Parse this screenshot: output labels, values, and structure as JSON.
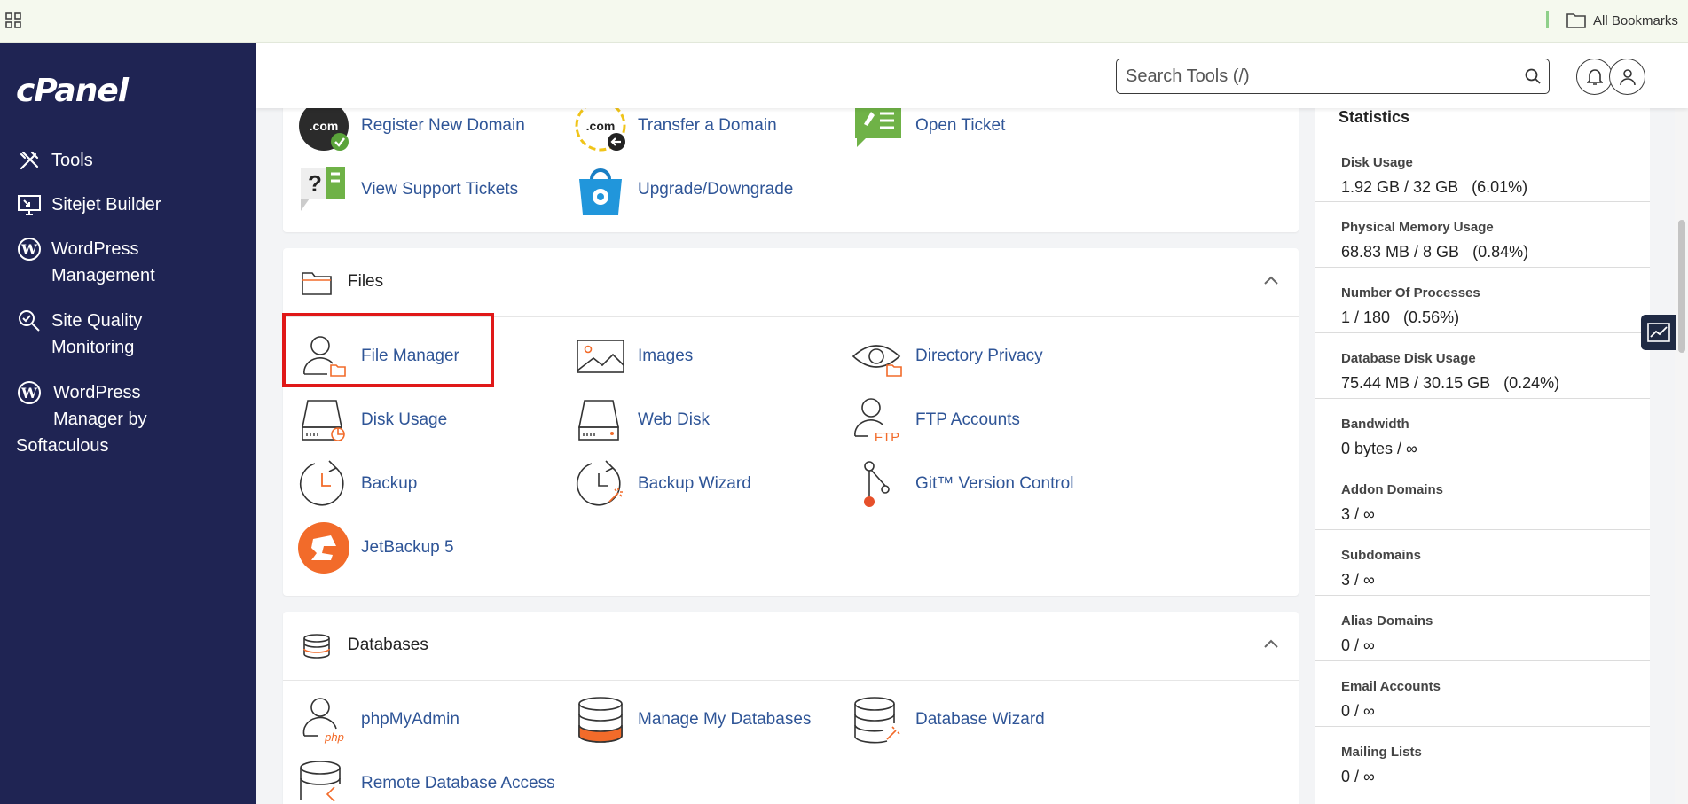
{
  "bookmarks_bar": {
    "all_bookmarks": "All Bookmarks"
  },
  "sidebar": {
    "logo": "cPanel",
    "items": [
      {
        "label_1": "Tools",
        "label_2": "",
        "icon": "tools-icon"
      },
      {
        "label_1": "Sitejet Builder",
        "label_2": "",
        "icon": "sitejet-icon"
      },
      {
        "label_1": "WordPress",
        "label_2": "Management",
        "icon": "wordpress-icon"
      },
      {
        "label_1": "Site Quality",
        "label_2": "Monitoring",
        "icon": "site-quality-icon"
      },
      {
        "label_1": "WordPress",
        "label_2": "Manager by",
        "label_3": "Softaculous",
        "icon": "wordpress-icon"
      }
    ]
  },
  "header": {
    "search_placeholder": "Search Tools (/)"
  },
  "domains_card": {
    "tools": [
      {
        "label": "Register New Domain",
        "icon": "register-domain-icon"
      },
      {
        "label": "Transfer a Domain",
        "icon": "transfer-domain-icon"
      },
      {
        "label": "Open Ticket",
        "icon": "open-ticket-icon"
      },
      {
        "label": "View Support Tickets",
        "icon": "support-tickets-icon"
      },
      {
        "label": "Upgrade/Downgrade",
        "icon": "upgrade-icon"
      }
    ]
  },
  "files_card": {
    "title": "Files",
    "tools": [
      {
        "label": "File Manager",
        "icon": "file-manager-icon"
      },
      {
        "label": "Images",
        "icon": "images-icon"
      },
      {
        "label": "Directory Privacy",
        "icon": "directory-privacy-icon"
      },
      {
        "label": "Disk Usage",
        "icon": "disk-usage-icon"
      },
      {
        "label": "Web Disk",
        "icon": "web-disk-icon"
      },
      {
        "label": "FTP Accounts",
        "icon": "ftp-accounts-icon"
      },
      {
        "label": "Backup",
        "icon": "backup-icon"
      },
      {
        "label": "Backup Wizard",
        "icon": "backup-wizard-icon"
      },
      {
        "label": "Git™ Version Control",
        "icon": "git-icon"
      },
      {
        "label": "JetBackup 5",
        "icon": "jetbackup-icon"
      }
    ]
  },
  "databases_card": {
    "title": "Databases",
    "tools": [
      {
        "label": "phpMyAdmin",
        "icon": "phpmyadmin-icon"
      },
      {
        "label": "Manage My Databases",
        "icon": "manage-databases-icon"
      },
      {
        "label": "Database Wizard",
        "icon": "database-wizard-icon"
      },
      {
        "label": "Remote Database Access",
        "icon": "remote-database-icon"
      }
    ]
  },
  "statistics": {
    "title": "Statistics",
    "rows": [
      {
        "label": "Disk Usage",
        "value": "1.92 GB / 32 GB   (6.01%)"
      },
      {
        "label": "Physical Memory Usage",
        "value": "68.83 MB / 8 GB   (0.84%)"
      },
      {
        "label": "Number Of Processes",
        "value": "1 / 180   (0.56%)"
      },
      {
        "label": "Database Disk Usage",
        "value": "75.44 MB / 30.15 GB   (0.24%)"
      },
      {
        "label": "Bandwidth",
        "value": "0 bytes / ∞"
      },
      {
        "label": "Addon Domains",
        "value": "3 / ∞"
      },
      {
        "label": "Subdomains",
        "value": "3 / ∞"
      },
      {
        "label": "Alias Domains",
        "value": "0 / ∞"
      },
      {
        "label": "Email Accounts",
        "value": "0 / ∞"
      },
      {
        "label": "Mailing Lists",
        "value": "0 / ∞"
      }
    ]
  },
  "colors": {
    "sidebar": "#1f2453",
    "link": "#2f5597",
    "accent": "#f26b2a",
    "highlight": "#e01818"
  }
}
